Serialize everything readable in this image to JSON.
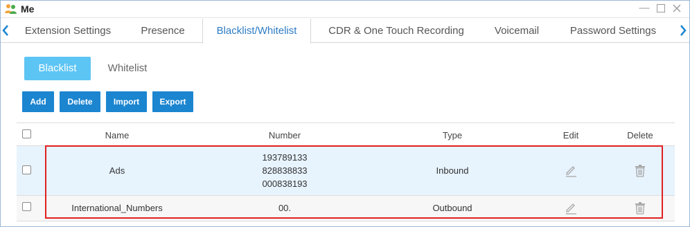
{
  "window": {
    "title": "Me"
  },
  "tabs": [
    {
      "label": "Extension Settings"
    },
    {
      "label": "Presence"
    },
    {
      "label": "Blacklist/Whitelist"
    },
    {
      "label": "CDR & One Touch Recording"
    },
    {
      "label": "Voicemail"
    },
    {
      "label": "Password Settings"
    }
  ],
  "subtabs": {
    "blacklist": "Blacklist",
    "whitelist": "Whitelist"
  },
  "toolbar": {
    "add": "Add",
    "delete": "Delete",
    "import": "Import",
    "export": "Export"
  },
  "table": {
    "headers": {
      "name": "Name",
      "number": "Number",
      "type": "Type",
      "edit": "Edit",
      "delete": "Delete"
    },
    "rows": [
      {
        "name": "Ads",
        "numbers": [
          "193789133",
          "828838833",
          "000838193"
        ],
        "type": "Inbound"
      },
      {
        "name": "International_Numbers",
        "numbers": [
          "00."
        ],
        "type": "Outbound"
      }
    ]
  },
  "colors": {
    "accent": "#1b85d0",
    "active_subtab": "#5dc5f4",
    "active_tab_text": "#2d7cc4",
    "highlight": "#e02020"
  }
}
